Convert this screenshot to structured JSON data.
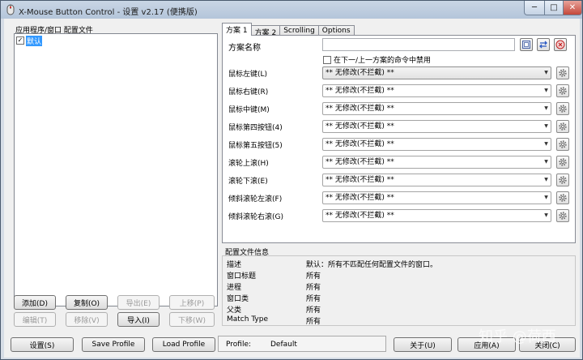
{
  "window": {
    "title": "X-Mouse Button Control - 设置 v2.17 (便携版)",
    "controls": {
      "minimize": "─",
      "maximize": "□",
      "close": "✕"
    }
  },
  "left_panel": {
    "label": "应用程序/窗口 配置文件",
    "profiles": [
      {
        "checked": true,
        "name": "默认"
      }
    ],
    "buttons": {
      "add": "添加(D)",
      "copy": "复制(O)",
      "export": "导出(E)",
      "move_up": "上移(P)",
      "edit": "编辑(T)",
      "remove": "移除(V)",
      "import": "导入(I)",
      "move_down": "下移(W)"
    }
  },
  "tabs": [
    {
      "label": "方案 1",
      "active": true
    },
    {
      "label": "方案 2",
      "active": false
    },
    {
      "label": "Scrolling",
      "active": false
    },
    {
      "label": "Options",
      "active": false
    }
  ],
  "scheme": {
    "name_label": "方案名称",
    "name_value": "",
    "disable_checkbox": {
      "checked": false,
      "label": "在下一/上一方案的命令中禁用"
    },
    "rows": [
      {
        "label": "鼠标左键(L)",
        "value": "** 无修改(不拦截) **"
      },
      {
        "label": "鼠标右键(R)",
        "value": "** 无修改(不拦截) **"
      },
      {
        "label": "鼠标中键(M)",
        "value": "** 无修改(不拦截) **"
      },
      {
        "label": "鼠标第四按钮(4)",
        "value": "** 无修改(不拦截) **"
      },
      {
        "label": "鼠标第五按钮(5)",
        "value": "** 无修改(不拦截) **"
      },
      {
        "label": "滚轮上滚(H)",
        "value": "** 无修改(不拦截) **"
      },
      {
        "label": "滚轮下滚(E)",
        "value": "** 无修改(不拦截) **"
      },
      {
        "label": "倾斜滚轮左滚(F)",
        "value": "** 无修改(不拦截) **"
      },
      {
        "label": "倾斜滚轮右滚(G)",
        "value": "** 无修改(不拦截) **"
      }
    ]
  },
  "profile_info": {
    "title": "配置文件信息",
    "rows": [
      {
        "key": "描述",
        "value": "默认：所有不匹配任何配置文件的窗口。"
      },
      {
        "key": "窗口标题",
        "value": "所有"
      },
      {
        "key": "进程",
        "value": "所有"
      },
      {
        "key": "窗口类",
        "value": "所有"
      },
      {
        "key": "父类",
        "value": "所有"
      },
      {
        "key": "Match Type",
        "value": "所有"
      }
    ]
  },
  "bottom_bar": {
    "settings": "设置(S)",
    "save_profile": "Save Profile",
    "load_profile": "Load Profile",
    "status_key": "Profile:",
    "status_value": "Default",
    "about": "关于(U)",
    "apply": "应用(A)",
    "close": "关闭(C)"
  },
  "watermark": "知乎 @荷西"
}
